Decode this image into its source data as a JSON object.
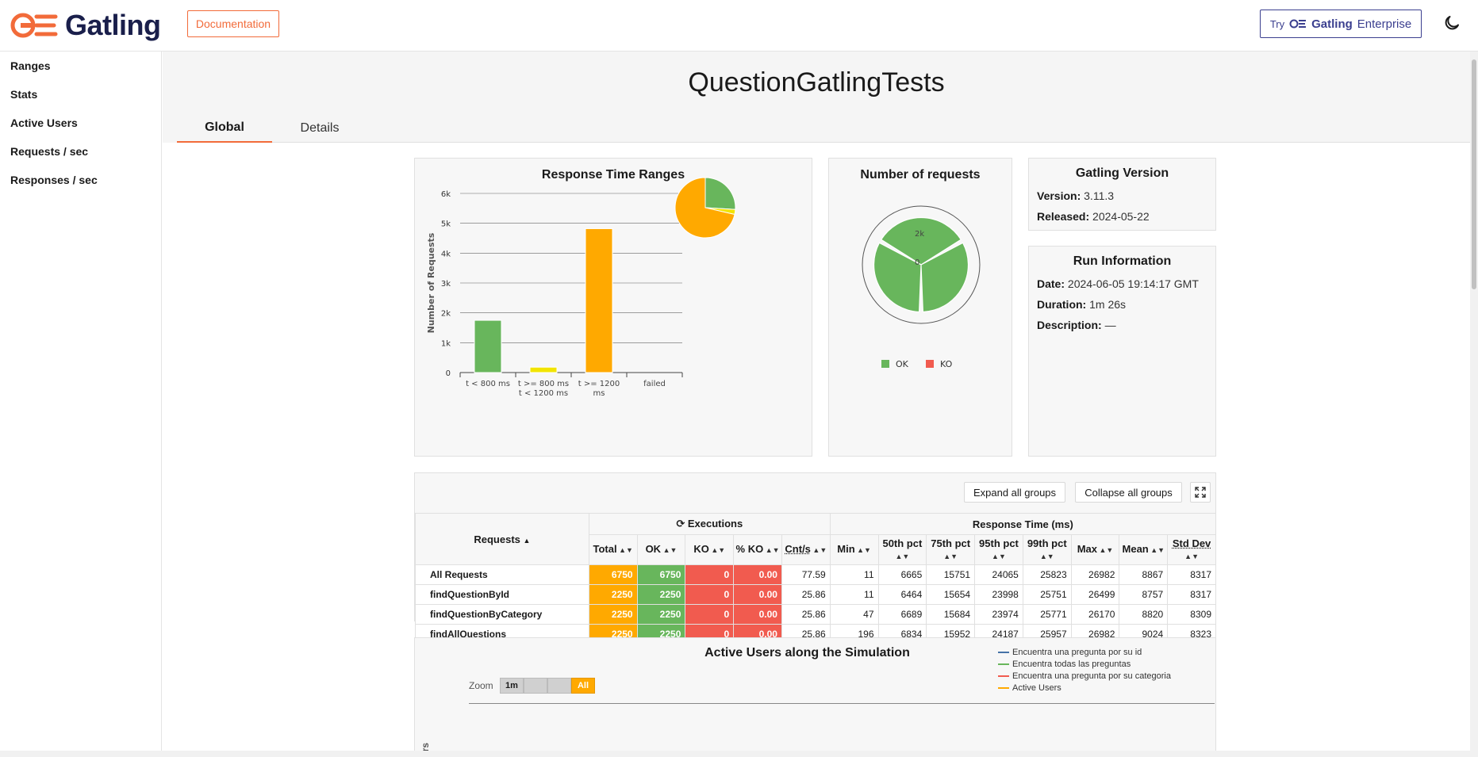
{
  "header": {
    "logo_text": "Gatling",
    "doc_button": "Documentation",
    "try_label": "Try",
    "enterprise_brand": "Gatling",
    "enterprise_suffix": "Enterprise",
    "accent": "#f26b3a",
    "brand_color": "#1a1f4b"
  },
  "sidebar": {
    "items": [
      {
        "label": "Ranges"
      },
      {
        "label": "Stats"
      },
      {
        "label": "Active Users"
      },
      {
        "label": "Requests / sec"
      },
      {
        "label": "Responses / sec"
      }
    ]
  },
  "page": {
    "title": "QuestionGatlingTests",
    "tabs": [
      {
        "label": "Global",
        "active": true
      },
      {
        "label": "Details",
        "active": false
      }
    ]
  },
  "response_time_ranges": {
    "title": "Response Time Ranges",
    "ylabel": "Number of Requests",
    "chart_data": {
      "type": "bar",
      "categories": [
        "t < 800 ms",
        "t >= 800 ms t < 1200 ms",
        "t >= 1200 ms",
        "failed"
      ],
      "category_lines": [
        [
          "t < 800 ms"
        ],
        [
          "t >= 800 ms",
          "t < 1200 ms"
        ],
        [
          "t >= 1200",
          "ms"
        ],
        [
          "failed"
        ]
      ],
      "values": [
        1750,
        180,
        4820,
        0
      ],
      "colors": [
        "#68b65c",
        "#f2e400",
        "#ffa900",
        "#f15b4f"
      ],
      "ylim": [
        0,
        6000
      ],
      "yticks": [
        "0",
        "1k",
        "2k",
        "3k",
        "4k",
        "5k",
        "6k"
      ],
      "grid": true
    },
    "pie": {
      "type": "pie",
      "values": [
        1750,
        180,
        4820,
        0
      ],
      "colors": [
        "#68b65c",
        "#f2e400",
        "#ffa900",
        "#f15b4f"
      ]
    }
  },
  "number_of_requests": {
    "title": "Number of requests",
    "chart_data": {
      "type": "pie",
      "categories": [
        "findQuestionById",
        "findQuestionByCategory",
        "findAllQuestions"
      ],
      "values": [
        2250,
        2250,
        2250
      ],
      "colors": [
        "#68b65c",
        "#68b65c",
        "#68b65c"
      ],
      "radial_ticks": [
        "2k",
        "0"
      ]
    },
    "legend": [
      {
        "label": "OK",
        "color": "#68b65c"
      },
      {
        "label": "KO",
        "color": "#f15b4f"
      }
    ]
  },
  "gatling_version": {
    "title": "Gatling Version",
    "version_label": "Version:",
    "version": "3.11.3",
    "released_label": "Released:",
    "released": "2024-05-22"
  },
  "run_information": {
    "title": "Run Information",
    "date_label": "Date:",
    "date": "2024-06-05 19:14:17 GMT",
    "duration_label": "Duration:",
    "duration": "1m 26s",
    "description_label": "Description:",
    "description": "—"
  },
  "stats_table": {
    "expand_label": "Expand all groups",
    "collapse_label": "Collapse all groups",
    "group_requests": "Requests",
    "group_executions": "Executions",
    "group_response_time": "Response Time (ms)",
    "columns": [
      "Total",
      "OK",
      "KO",
      "% KO",
      "Cnt/s",
      "Min",
      "50th pct",
      "75th pct",
      "95th pct",
      "99th pct",
      "Max",
      "Mean",
      "Std Dev"
    ],
    "rows": [
      {
        "name": "All Requests",
        "values": [
          "6750",
          "6750",
          "0",
          "0.00",
          "77.59",
          "11",
          "6665",
          "15751",
          "24065",
          "25823",
          "26982",
          "8867",
          "8317"
        ]
      },
      {
        "name": "findQuestionById",
        "values": [
          "2250",
          "2250",
          "0",
          "0.00",
          "25.86",
          "11",
          "6464",
          "15654",
          "23998",
          "25751",
          "26499",
          "8757",
          "8317"
        ]
      },
      {
        "name": "findQuestionByCategory",
        "values": [
          "2250",
          "2250",
          "0",
          "0.00",
          "25.86",
          "47",
          "6689",
          "15684",
          "23974",
          "25771",
          "26170",
          "8820",
          "8309"
        ]
      },
      {
        "name": "findAllQuestions",
        "values": [
          "2250",
          "2250",
          "0",
          "0.00",
          "25.86",
          "196",
          "6834",
          "15952",
          "24187",
          "25957",
          "26982",
          "9024",
          "8323"
        ]
      }
    ]
  },
  "active_users": {
    "title": "Active Users along the Simulation",
    "zoom_label": "Zoom",
    "zoom_options": [
      "1m",
      "",
      "",
      "All"
    ],
    "ylabel_partial": "ers",
    "legend": [
      {
        "label": "Encuentra una pregunta por su id",
        "color": "#4572a7"
      },
      {
        "label": "Encuentra todas las preguntas",
        "color": "#68b65c"
      },
      {
        "label": "Encuentra una pregunta por su categoria",
        "color": "#f15b4f"
      },
      {
        "label": "Active Users",
        "color": "#ffa900"
      }
    ]
  }
}
